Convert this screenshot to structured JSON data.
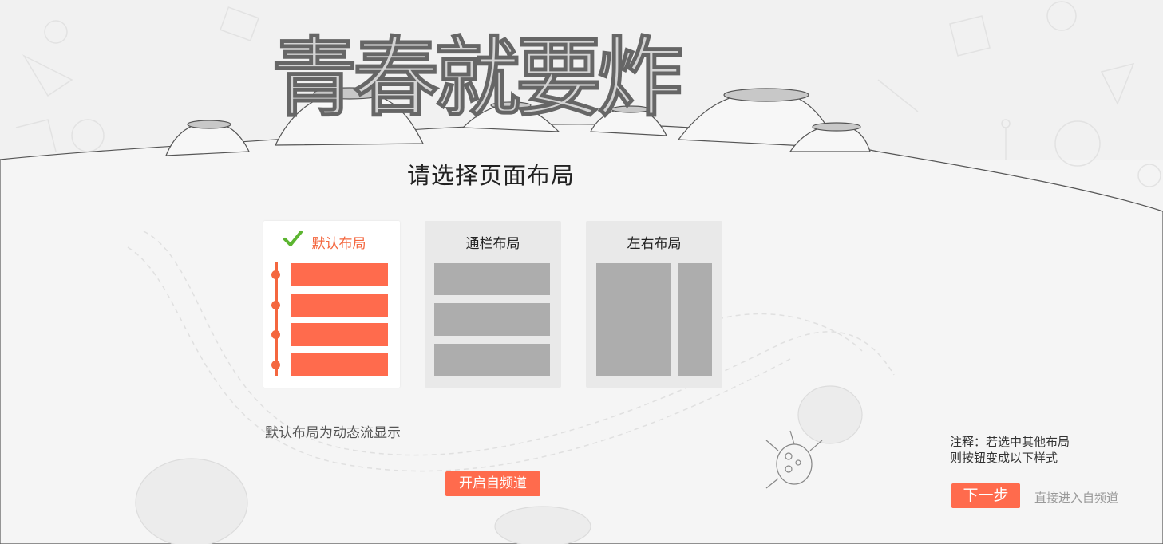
{
  "page": {
    "heading": "请选择页面布局",
    "banner_text": "青春就要炸"
  },
  "layouts": [
    {
      "label": "默认布局",
      "selected": true
    },
    {
      "label": "通栏布局",
      "selected": false
    },
    {
      "label": "左右布局",
      "selected": false
    }
  ],
  "description": "默认布局为动态流显示",
  "buttons": {
    "open_channel": "开启自频道",
    "next": "下一步",
    "direct_enter": "直接进入自频道"
  },
  "note": {
    "line1": "注释：若选中其他布局",
    "line2": "则按钮变成以下样式"
  },
  "colors": {
    "accent": "#ff6b4d",
    "check": "#5cb531",
    "placeholder_gray": "#adadad",
    "background": "#f4f4f4"
  }
}
